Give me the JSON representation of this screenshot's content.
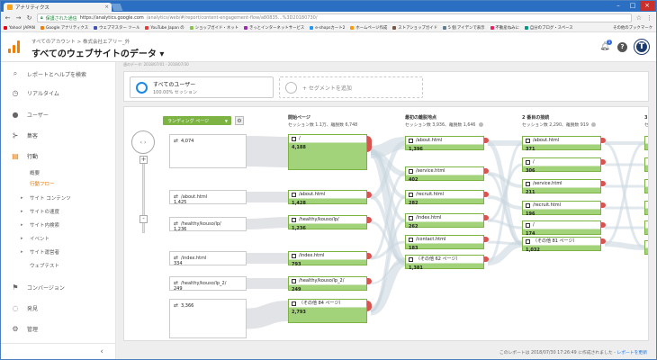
{
  "browser": {
    "tab_title": "アナリティクス",
    "url_secure": "保護された通信",
    "url_host": "https://analytics.google.com",
    "url_path": "/analytics/web/#/report/content-engagement-flow/a80835...%3D20180730/"
  },
  "bookmarks": [
    {
      "label": "Yahoo! JAPAN",
      "color": "#e60012"
    },
    {
      "label": "Google アナリティクス",
      "color": "#f57c00"
    },
    {
      "label": "ウェブマスター ツール",
      "color": "#3f51b5"
    },
    {
      "label": "YouTube Japan の",
      "color": "#e53935"
    },
    {
      "label": "ショップガイド・ネット",
      "color": "#8bc34a"
    },
    {
      "label": "きっとインターネットサービス",
      "color": "#9c27b0"
    },
    {
      "label": "e-shopsカート2",
      "color": "#2196f3"
    },
    {
      "label": "ホームページ作成",
      "color": "#ff9800"
    },
    {
      "label": "ストアショップガイド",
      "color": "#795548"
    },
    {
      "label": "5 個 アイデンで表示",
      "color": "#607d8b"
    },
    {
      "label": "不動産ねみに",
      "color": "#e91e63"
    },
    {
      "label": "自分のブログ・スペース",
      "color": "#009688"
    }
  ],
  "bookmarks_other": "その他のブックマーク",
  "header": {
    "breadcrumb": "すべてのアカウント > 株式会社エアリー_外",
    "title": "すべてのウェブサイトのデータ ▾",
    "notification_count": "1",
    "help": "?",
    "avatar": "T"
  },
  "sidebar": {
    "search": "レポートとヘルプを検索",
    "realtime": "リアルタイム",
    "users": "ユーザー",
    "acquisition": "集客",
    "behavior": "行動",
    "sub": [
      "概要",
      "行動フロー",
      "サイト コンテンツ",
      "サイトの速度",
      "サイト内検索",
      "イベント",
      "サイト運営者",
      "ウェブテスト"
    ],
    "conversions": "コンバージョン",
    "discover": "発見",
    "admin": "管理",
    "collapse": "‹"
  },
  "main": {
    "top_strip": "週のデータ: 2018/07/01 - 2018/07/30",
    "segment": {
      "name": "すべてのユーザー",
      "pct": "100.00% セッション"
    },
    "add_segment": "+ セグメントを追加"
  },
  "flow": {
    "dimension": "ランディング ページ",
    "columns": [
      {
        "title": "開始ページ",
        "sub": "セッション数 1.1万、離脱数 6,748"
      },
      {
        "title": "最初の離脱地点",
        "sub": "セッション数 3,936、離脱数 1,646"
      },
      {
        "title": "2 番目の接続",
        "sub": "セッション数 2,290、離脱数 919"
      },
      {
        "title": "3 番",
        "sub": "セッ"
      }
    ],
    "sources": [
      {
        "label": "",
        "value": "4,074"
      },
      {
        "label": "/about.html",
        "value": "1,425"
      },
      {
        "label": "/healthy/kouso/lp/",
        "value": "1,236"
      },
      {
        "label": "/index.html",
        "value": "334"
      },
      {
        "label": "/healthy/kouso/lp_2/",
        "value": "249"
      },
      {
        "label": "",
        "value": "3,366"
      }
    ],
    "col1": [
      {
        "label": "/",
        "value": "4,188"
      },
      {
        "label": "/about.html",
        "value": "1,428"
      },
      {
        "label": "/healthy/kouso/lp/",
        "value": "1,236"
      },
      {
        "label": "/index.html",
        "value": "793"
      },
      {
        "label": "/healthy/kouso/lp_2/",
        "value": "249"
      },
      {
        "label": "（その他 84 ページ）",
        "value": "2,793"
      }
    ],
    "col2": [
      {
        "label": "/about.html",
        "value": "1,396"
      },
      {
        "label": "/service.html",
        "value": "402"
      },
      {
        "label": "/recruit.html",
        "value": "282"
      },
      {
        "label": "/index.html",
        "value": "262"
      },
      {
        "label": "/contact.html",
        "value": "183"
      },
      {
        "label": "（その他 62 ページ）",
        "value": "1,381"
      }
    ],
    "col3": [
      {
        "label": "/about.html",
        "value": "371"
      },
      {
        "label": "/",
        "value": "306"
      },
      {
        "label": "/service.html",
        "value": "211"
      },
      {
        "label": "/recruit.html",
        "value": "196"
      },
      {
        "label": "/",
        "value": "174"
      },
      {
        "label": "（その他 81 ページ）",
        "value": "1,032"
      }
    ],
    "col4": [
      "",
      "",
      "",
      "",
      "",
      ""
    ]
  },
  "footer": {
    "text": "このレポートは 2018/07/30 17:26:49 に作成されました - ",
    "link": "レポートを更新"
  },
  "colors": {
    "node_green": "#a2d37a",
    "dropoff_red": "#d9534f",
    "accent_orange": "#e37400",
    "tab_blue": "#2b6fc2"
  }
}
